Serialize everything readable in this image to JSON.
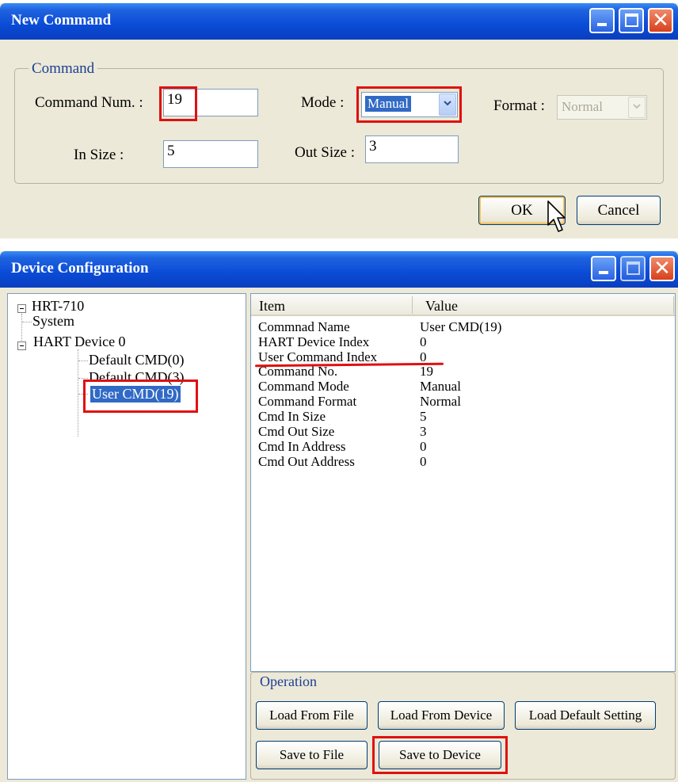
{
  "new_command": {
    "title": "New Command",
    "group_label": "Command",
    "command_num_label": "Command Num. :",
    "command_num_value": "19",
    "mode_label": "Mode :",
    "mode_value": "Manual",
    "format_label": "Format :",
    "format_value": "Normal",
    "in_size_label": "In Size :",
    "in_size_value": "5",
    "out_size_label": "Out Size :",
    "out_size_value": "3",
    "ok_label": "OK",
    "cancel_label": "Cancel"
  },
  "device_config": {
    "title": "Device Configuration",
    "tree": {
      "root": "HRT-710",
      "system": "System",
      "hart_device": "HART Device 0",
      "default_cmd_0": "Default CMD(0)",
      "default_cmd_3": "Default CMD(3)",
      "user_cmd_19": "User CMD(19)"
    },
    "list": {
      "col_item": "Item",
      "col_value": "Value",
      "rows": [
        {
          "item": "Commnad Name",
          "value": "User CMD(19)"
        },
        {
          "item": "HART Device Index",
          "value": "0"
        },
        {
          "item": "User Command Index",
          "value": "0"
        },
        {
          "item": "Command No.",
          "value": "19"
        },
        {
          "item": "Command Mode",
          "value": "Manual"
        },
        {
          "item": "Command Format",
          "value": "Normal"
        },
        {
          "item": "Cmd In Size",
          "value": "5"
        },
        {
          "item": "Cmd Out Size",
          "value": "3"
        },
        {
          "item": "Cmd In Address",
          "value": "0"
        },
        {
          "item": "Cmd Out Address",
          "value": "0"
        }
      ]
    },
    "operation": {
      "label": "Operation",
      "load_from_file": "Load From File",
      "load_from_device": "Load From Device",
      "load_default_setting": "Load Default Setting",
      "save_to_file": "Save to File",
      "save_to_device": "Save to Device"
    }
  },
  "colors": {
    "titlebar": "#0a4bd6",
    "window_bg": "#ece9d8",
    "selection": "#316ac5",
    "highlight_red": "#e01010"
  }
}
